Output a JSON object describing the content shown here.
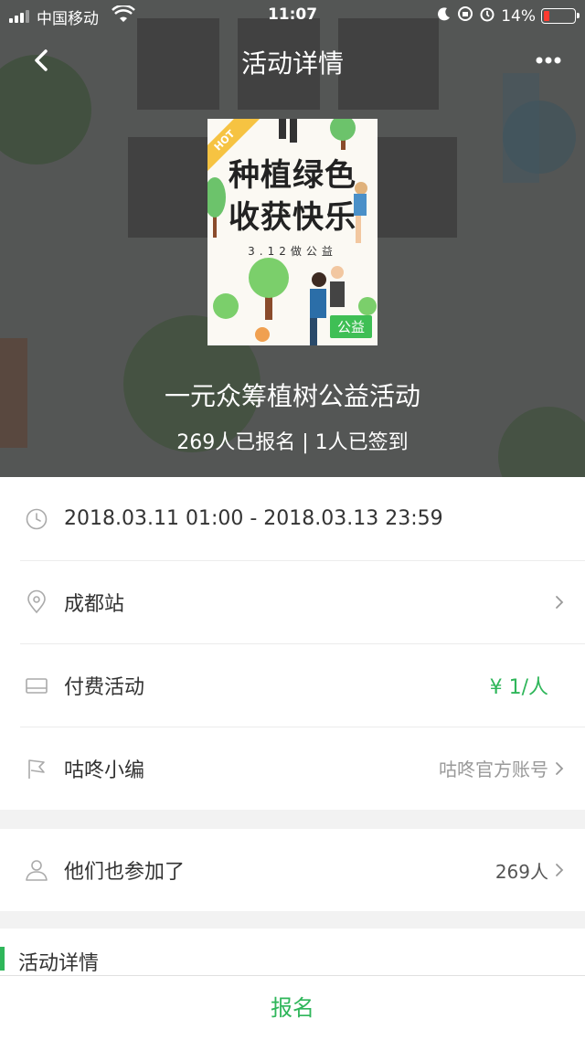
{
  "status_bar": {
    "carrier": "中国移动",
    "time": "11:07",
    "battery_percent": "14%"
  },
  "nav": {
    "title": "活动详情",
    "back_icon": "chevron-left-icon",
    "more_icon": "more-dots-icon"
  },
  "poster": {
    "hot_label": "HOT",
    "line1": "种植绿色",
    "line2": "收获快乐",
    "date_line": "3.12做公益",
    "badge": "公益"
  },
  "event": {
    "title": "一元众筹植树公益活动",
    "stats": "269人已报名 | 1人已签到"
  },
  "info": {
    "time": "2018.03.11 01:00 - 2018.03.13 23:59",
    "location": "成都站",
    "fee_type": "付费活动",
    "price": "¥ 1/人",
    "organizer": "咕咚小编",
    "organizer_account": "咕咚官方账号"
  },
  "participants": {
    "label": "他们也参加了",
    "count": "269人"
  },
  "details": {
    "label": "活动详情"
  },
  "signup_label": "报名",
  "colors": {
    "accent": "#2fb65a",
    "hero_overlay": "#464a49"
  }
}
